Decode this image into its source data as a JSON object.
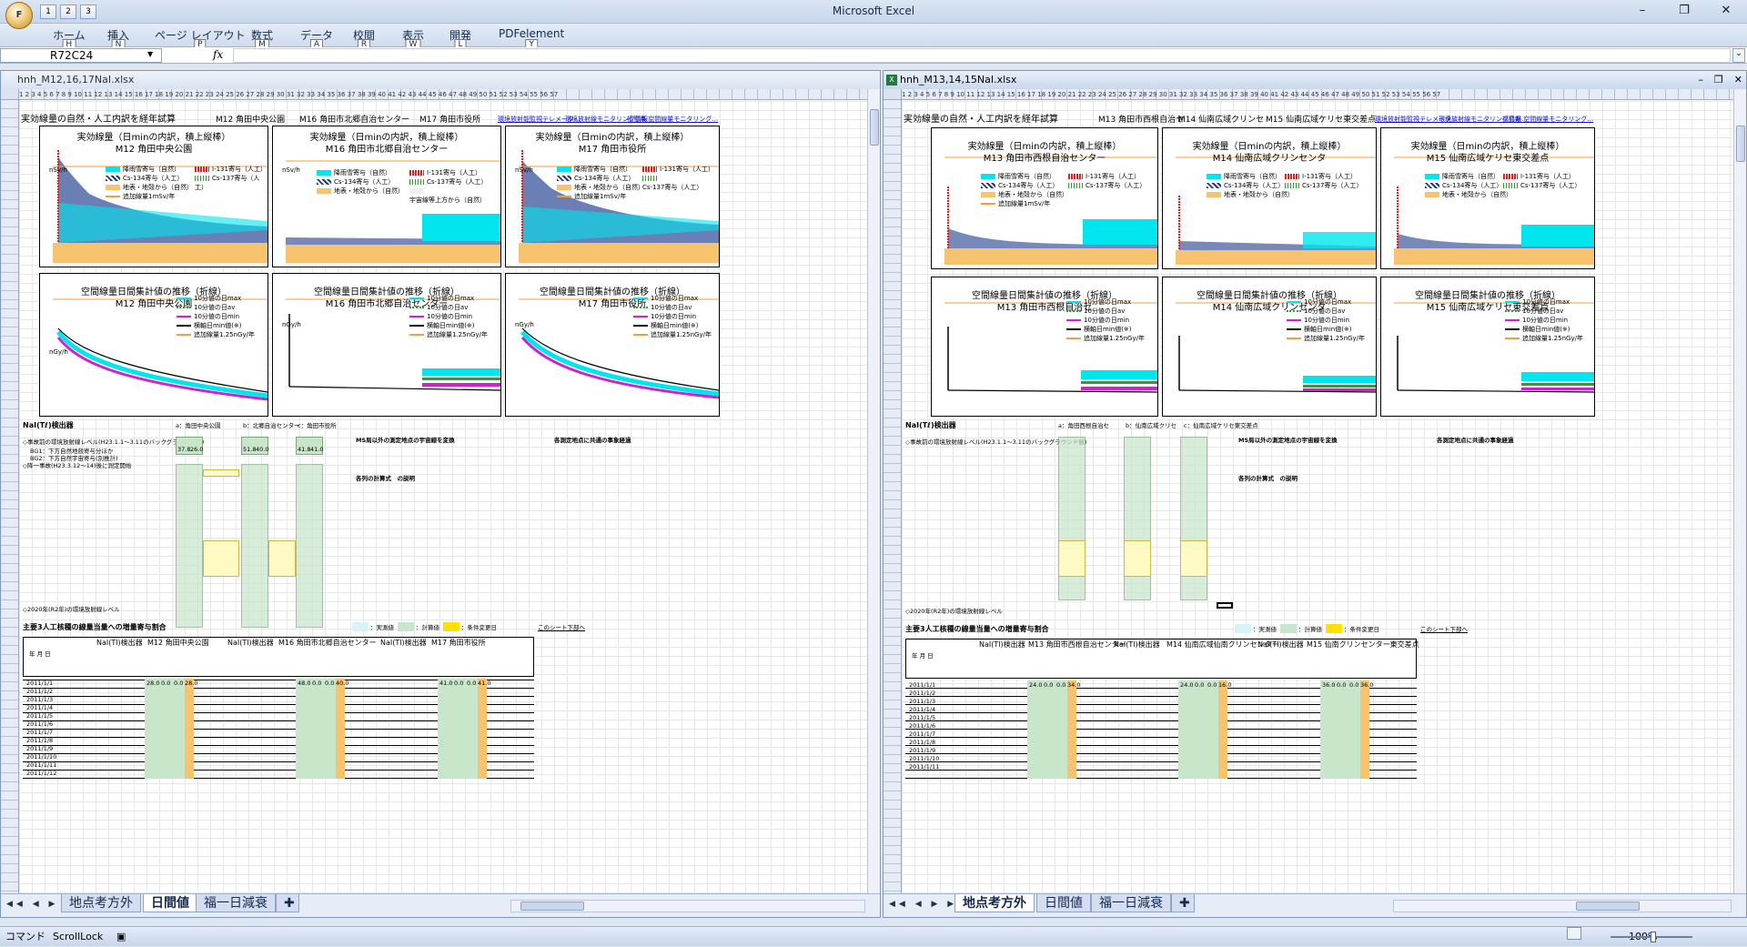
{
  "app": {
    "title": "Microsoft Excel",
    "office_button_label": "F",
    "qat": [
      "1",
      "2",
      "3"
    ],
    "window_controls": [
      "–",
      "❐",
      "✕"
    ]
  },
  "ribbon": {
    "tabs": [
      {
        "label": "ホーム",
        "key": "H"
      },
      {
        "label": "挿入",
        "key": "N"
      },
      {
        "label": "ページ レイアウト",
        "key": "P"
      },
      {
        "label": "数式",
        "key": "M"
      },
      {
        "label": "データ",
        "key": "A"
      },
      {
        "label": "校閲",
        "key": "R"
      },
      {
        "label": "表示",
        "key": "W"
      },
      {
        "label": "開発",
        "key": "L"
      },
      {
        "label": "PDFelement",
        "key": "Y"
      }
    ]
  },
  "formula_bar": {
    "name_box": "R72C24",
    "fx": "fx",
    "value": ""
  },
  "left_wb": {
    "filename": "hnh_M12,16,17NaI.xlsx",
    "title_text": "実効線量の自然・人工内訳を経年試算",
    "header_sites": [
      "M12 角田中央公園",
      "M16 角田市北郷自治センター",
      "M17 角田市役所"
    ],
    "links": [
      "環境放射能監視テレメータ…",
      "環境放射線モニタリング情報…",
      "福島県 空間線量モニタリング…"
    ],
    "sheets": [
      "地点考方外",
      "日間値",
      "福一日減衰"
    ],
    "active_sheet": 2
  },
  "right_wb": {
    "filename": "hnh_M13,14,15NaI.xlsx",
    "title_text": "実効線量の自然・人工内訳を経年試算",
    "header_sites": [
      "M13 角田市西根自治セ",
      "M14 仙南広域クリンセ",
      "M15 仙南広域ケリセ東交差点"
    ],
    "links": [
      "環境放射能監視テレメータ…",
      "環境放射線モニタリング情報…",
      "福島県 空間線量モニタリング…"
    ],
    "sheets": [
      "地点考方外",
      "日間値",
      "福一日減衰"
    ],
    "active_sheet": 0
  },
  "charts_top_common": {
    "title1": "実効線量（日minの内訳，積上縦棒）",
    "unit": "nSv/h",
    "legend": [
      "降雨雪寄与（自然）",
      "I-131寄与（人工）",
      "Cs-134寄与（人工）",
      "Cs-137寄与（人工）",
      "地表・地殻から（自然）",
      "宇宙線等上方から（自然）",
      "追加線量1mSv/年"
    ]
  },
  "charts_bottom_common": {
    "title1": "空間線量日間集計値の推移（折線）",
    "unit": "nGy/h",
    "legend": [
      "10分値の日max",
      "10分値の日av",
      "10分値の日min",
      "横軸日min値(※)",
      "追加線量1.25nGy/年"
    ]
  },
  "charts": {
    "left_top": [
      "M12 角田中央公園",
      "M16 角田市北郷自治センター",
      "M17 角田市役所"
    ],
    "left_bottom": [
      "M12 角田中央公園",
      "M16 角田市北郷自治センター",
      "M17 角田市役所"
    ],
    "right_top": [
      "M13 角田市西根自治センター",
      "M14 仙南広域クリンセンタ",
      "M15 仙南広域ケリセ東交差点"
    ],
    "right_bottom": [
      "M13 角田市西根自治セ",
      "M14 仙南広域クリンセンタ",
      "M15 仙南広域ケリセ東交差点"
    ]
  },
  "sheet_text": {
    "left_section": "NaI(Tℓ)検出器",
    "left_sites": [
      "a：角田中央公園",
      "b：北郷自治センター",
      "c：角田市役所"
    ],
    "right_section": "NaI(Tℓ)検出器",
    "right_sites": [
      "a：角田西根自治セ",
      "b：仙南広域クリセ",
      "c：仙南広域ケリセ東交差点"
    ],
    "row_labels": [
      "◇事故前の環境放射線レベル(H23.1.1～3.11のバックグラウンド値)",
      "BG1：下方自然地殻寄与分ほか",
      "BG2：下方自然宇宙寄与(別推計)",
      "◇降一事故(H23.3.12～14)後に測定開始",
      "◇2020年(R2年)の環境放射線レベル"
    ],
    "left_vals": [
      "37.8",
      "26.0",
      "51.8",
      "40.0",
      "41.8",
      "41.0"
    ],
    "notes_title": "MS局以外の測定地点の宇宙線を変換",
    "formula_title": "各列の計算式　の説明",
    "events_title": "各測定地点に共通の事象経過",
    "sum_title": "主要3人工核種の線量当量への増量寄与割合",
    "legend_labels": [
      "：実測値",
      "：計算値",
      "：条件変更日"
    ],
    "copy_link": "このシート下部へ",
    "table_header": [
      "年 月 日",
      "NaI(Tl)検出器",
      "M12 角田中央公園",
      "NaI(Tl)検出器",
      "M16 角田市北郷自治センター",
      "NaI(Tl)検出器",
      "M17 角田市役所"
    ],
    "right_table_header": [
      "年 月 日",
      "NaI(Tl)検出器",
      "M13 角田市西根自治センター",
      "NaI(Tl)検出器",
      "M14 仙南広域仙南クリンセンター",
      "NaI(Tl)検出器",
      "M15 仙南クリンセンター東交差点"
    ],
    "dates": [
      "2011/1/1",
      "2011/1/2",
      "2011/1/3",
      "2011/1/4",
      "2011/1/5",
      "2011/1/6",
      "2011/1/7",
      "2011/1/8",
      "2011/1/9",
      "2011/1/10",
      "2011/1/11",
      "2011/1/12"
    ],
    "left_row_vals": [
      "28.0",
      "0.0",
      "0.0",
      "28.0",
      "48.0",
      "0.0",
      "0.0",
      "40.0",
      "41.0",
      "0.0",
      "0.0",
      "41.0"
    ],
    "right_row_vals": [
      "24.0",
      "0.0",
      "0.0",
      "34.0",
      "24.0",
      "0.0",
      "0.0",
      "16.0",
      "36.0",
      "0.0",
      "0.0",
      "36.0"
    ]
  },
  "statusbar": {
    "mode": "コマンド",
    "scroll_lock": "ScrollLock",
    "zoom": "100%"
  },
  "colors": {
    "cyan": "#00e5ee",
    "navy_hatch": "#1a3a8a",
    "orange_band": "#f7c36e",
    "magenta": "#d020d0",
    "green": "#2e9e2e",
    "red": "#e02020"
  }
}
